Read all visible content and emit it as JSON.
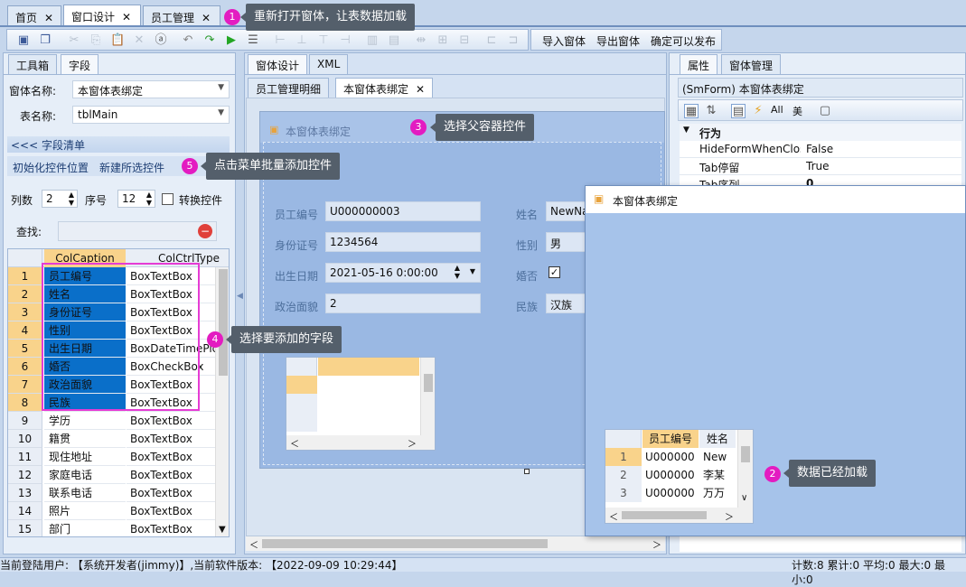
{
  "doc_tabs": [
    {
      "label": "首页",
      "close": "✕"
    },
    {
      "label": "窗口设计",
      "close": "✕"
    },
    {
      "label": "员工管理",
      "close": "✕"
    }
  ],
  "toolbar": {
    "import_label": "导入窗体",
    "export_label": "导出窗体",
    "publish_label": "确定可以发布"
  },
  "left": {
    "tab_toolbox": "工具箱",
    "tab_fields": "字段",
    "form_name_label": "窗体名称:",
    "form_name_value": "本窗体表绑定",
    "table_name_label": "表名称:",
    "table_name_value": "tblMain",
    "field_list_header": "<<< 字段清单",
    "init_positions": "初始化控件位置",
    "new_controls": "新建所选控件",
    "cols_label": "列数",
    "cols_value": "2",
    "order_label": "序号",
    "order_value": "12",
    "convert_label": "转换控件",
    "search_label": "查找:",
    "grid_headers": [
      "ColCaption",
      "ColCtrlType"
    ],
    "rows": [
      {
        "n": "1",
        "c": "员工编号",
        "t": "BoxTextBox",
        "sel": true
      },
      {
        "n": "2",
        "c": "姓名",
        "t": "BoxTextBox",
        "sel": true
      },
      {
        "n": "3",
        "c": "身份证号",
        "t": "BoxTextBox",
        "sel": true
      },
      {
        "n": "4",
        "c": "性别",
        "t": "BoxTextBox",
        "sel": true
      },
      {
        "n": "5",
        "c": "出生日期",
        "t": "BoxDateTimePic",
        "sel": true
      },
      {
        "n": "6",
        "c": "婚否",
        "t": "BoxCheckBox",
        "sel": true
      },
      {
        "n": "7",
        "c": "政治面貌",
        "t": "BoxTextBox",
        "sel": true
      },
      {
        "n": "8",
        "c": "民族",
        "t": "BoxTextBox",
        "sel": true
      },
      {
        "n": "9",
        "c": "学历",
        "t": "BoxTextBox",
        "sel": false
      },
      {
        "n": "10",
        "c": "籍贯",
        "t": "BoxTextBox",
        "sel": false
      },
      {
        "n": "11",
        "c": "现住地址",
        "t": "BoxTextBox",
        "sel": false
      },
      {
        "n": "12",
        "c": "家庭电话",
        "t": "BoxTextBox",
        "sel": false
      },
      {
        "n": "13",
        "c": "联系电话",
        "t": "BoxTextBox",
        "sel": false
      },
      {
        "n": "14",
        "c": "照片",
        "t": "BoxTextBox",
        "sel": false
      },
      {
        "n": "15",
        "c": "部门",
        "t": "BoxTextBox",
        "sel": false
      }
    ]
  },
  "center": {
    "tab_design": "窗体设计",
    "tab_xml": "XML",
    "subtab_emp": "员工管理明细",
    "subtab_bind": "本窗体表绑定",
    "subtab_close": "✕",
    "form_title": "本窗体表绑定",
    "fields": {
      "emp_no_label": "员工编号",
      "emp_no_value": "U000000003",
      "name_label": "姓名",
      "name_value": "NewNa",
      "id_label": "身份证号",
      "id_value": "1234564",
      "gender_label": "性别",
      "gender_value": "男",
      "birth_label": "出生日期",
      "birth_value": "2021-05-16 0:00:00",
      "married_label": "婚否",
      "political_label": "政治面貌",
      "political_value": "2",
      "ethnic_label": "民族",
      "ethnic_value": "汉族"
    }
  },
  "popup": {
    "title": "本窗体表绑定",
    "headers": [
      "员工编号",
      "姓名"
    ],
    "rows": [
      {
        "n": "1",
        "id": "U000000",
        "name": "New"
      },
      {
        "n": "2",
        "id": "U000000",
        "name": "李某"
      },
      {
        "n": "3",
        "id": "U000000",
        "name": "万万"
      }
    ]
  },
  "right": {
    "tab_props": "属性",
    "tab_forms": "窗体管理",
    "object": "(SmForm) 本窗体表绑定",
    "all_label": "All",
    "cn_label": "美",
    "section": "行为",
    "props": [
      {
        "k": "HideFormWhenClos",
        "v": "False"
      },
      {
        "k": "Tab停留",
        "v": "True"
      },
      {
        "k": "Tab序列",
        "v": "0"
      }
    ]
  },
  "annotations": [
    {
      "num": "1",
      "text": "重新打开窗体，让表数据加载"
    },
    {
      "num": "2",
      "text": "数据已经加载"
    },
    {
      "num": "3",
      "text": "选择父容器控件"
    },
    {
      "num": "4",
      "text": "选择要添加的字段"
    },
    {
      "num": "5",
      "text": "点击菜单批量添加控件"
    }
  ],
  "status": {
    "left": "当前登陆用户: 【系统开发者(jimmy)】,当前软件版本: 【2022-09-09 10:29:44】",
    "right": "计数:8 累计:0 平均:0 最大:0 最小:0"
  }
}
